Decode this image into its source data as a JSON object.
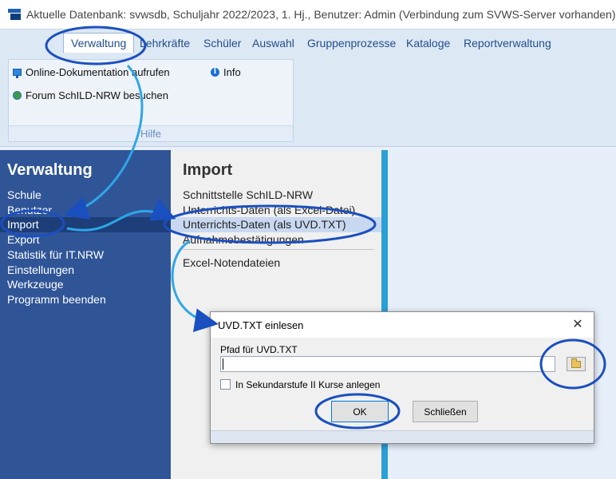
{
  "window": {
    "title": "Aktuelle Datenbank: svwsdb, Schuljahr 2022/2023, 1. Hj., Benutzer: Admin (Verbindung zum SVWS-Server vorhanden)"
  },
  "menu": {
    "items": [
      "Verwaltung",
      "Lehrkräfte",
      "Schüler",
      "Auswahl",
      "Gruppenprozesse",
      "Kataloge",
      "Reportverwaltung"
    ],
    "active_index": 0
  },
  "ribbon": {
    "group_label": "Hilfe",
    "buttons": {
      "online_docs": "Online-Dokumentation aufrufen",
      "info": "Info",
      "forum": "Forum SchILD-NRW besuchen"
    }
  },
  "nav": {
    "title": "Verwaltung",
    "items": [
      "Schule",
      "Benutzer",
      "Import",
      "Export",
      "Statistik für IT.NRW",
      "Einstellungen",
      "Werkzeuge",
      "Programm beenden"
    ],
    "selected_index": 2
  },
  "import_panel": {
    "title": "Import",
    "items": [
      "Schnittstelle SchILD-NRW",
      "Unterrichts-Daten (als Excel-Datei)",
      "Unterrichts-Daten (als UVD.TXT)",
      "Aufnahmebestätigungen",
      "Excel-Notendateien"
    ],
    "selected_index": 2
  },
  "dialog": {
    "title": "UVD.TXT einlesen",
    "path_label": "Pfad für UVD.TXT",
    "path_value": "",
    "checkbox_label": "In Sekundarstufe II Kurse anlegen",
    "checkbox_checked": false,
    "ok_label": "OK",
    "close_label": "Schließen"
  },
  "colors": {
    "nav_background": "#2f5597",
    "annotation": "#1a4fbf",
    "arrow": "#2ea6e8"
  }
}
